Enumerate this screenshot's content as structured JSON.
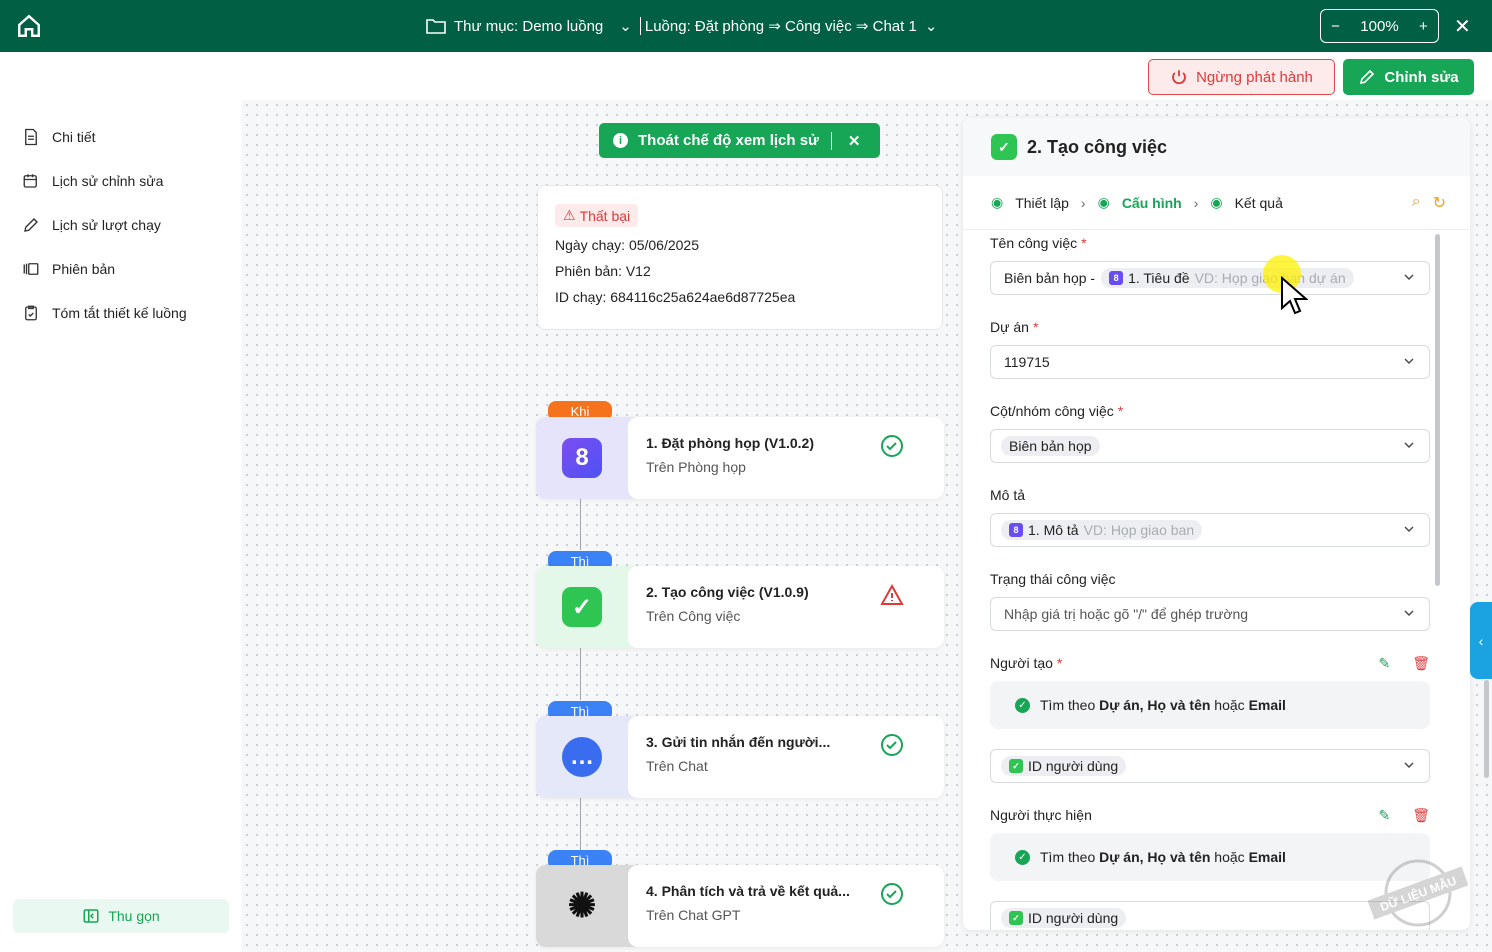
{
  "topbar": {
    "folder": "Thư mục: Demo luồng",
    "flow": "Luồng: Đặt phòng ⇒ Công việc ⇒ Chat 1",
    "zoom": "100%",
    "zoom_minus": "−",
    "zoom_plus": "+",
    "close": "✕"
  },
  "actions": {
    "stop": "Ngừng phát hành",
    "edit": "Chỉnh sửa"
  },
  "sidebar": {
    "items": [
      {
        "label": "Chi tiết",
        "icon": "document-icon"
      },
      {
        "label": "Lịch sử chỉnh sửa",
        "icon": "calendar-history-icon"
      },
      {
        "label": "Lịch sử lượt chạy",
        "icon": "pen-history-icon"
      },
      {
        "label": "Phiên bản",
        "icon": "versions-icon"
      },
      {
        "label": "Tóm tắt thiết kế luồng",
        "icon": "clipboard-icon"
      }
    ],
    "collapse": "Thu gọn"
  },
  "history_banner": {
    "label": "Thoát chế độ xem lịch sử",
    "close": "✕"
  },
  "run_info": {
    "status": "Thất bại",
    "date_label": "Ngày chạy:",
    "date": "05/06/2025",
    "version_label": "Phiên bản:",
    "version": "V12",
    "id_label": "ID chạy:",
    "id": "684116c25a624ae6d87725ea"
  },
  "nodes": [
    {
      "tag": "Khi",
      "title": "1.  Đặt phòng họp (V1.0.2)",
      "subtitle": "Trên Phòng họp",
      "status": "success",
      "tag_color": "#f5731c",
      "bg": "#e6e4fb"
    },
    {
      "tag": "Thì",
      "title": "2.  Tạo công việc (V1.0.9)",
      "subtitle": "Trên Công việc",
      "status": "warning",
      "tag_color": "#3b82f6",
      "bg": "#e3f8e8"
    },
    {
      "tag": "Thì",
      "title": "3.  Gửi tin nhắn đến người...",
      "subtitle": "Trên Chat",
      "status": "success",
      "tag_color": "#3b82f6",
      "bg": "#e4e8f8"
    },
    {
      "tag": "Thì",
      "title": "4.  Phân tích và trả về kết quả...",
      "subtitle": "Trên Chat GPT",
      "status": "success",
      "tag_color": "#3b82f6",
      "bg": "#d9d9d9"
    }
  ],
  "panel": {
    "title": "2. Tạo công việc",
    "steps": [
      "Thiết lập",
      "Cấu hình",
      "Kết quả"
    ],
    "fields": {
      "name": {
        "label": "Tên công việc",
        "prefix": "Biên bản họp -",
        "chip": "1. Tiêu đề",
        "chip_hint": "VD: Họp giao ban dự án"
      },
      "project": {
        "label": "Dự án",
        "value": "119715"
      },
      "column": {
        "label": "Cột/nhóm công việc",
        "chip": "Biên bản họp"
      },
      "desc": {
        "label": "Mô tả",
        "chip": "1. Mô tả",
        "chip_hint": "VD: Họp giao ban"
      },
      "status": {
        "label": "Trạng thái công việc",
        "placeholder": "Nhập giá trị hoặc gõ \"/\" để ghép trường"
      },
      "creator": {
        "label": "Người tạo",
        "find_pre": "Tìm theo ",
        "find_b1": "Dự án, Họ và tên",
        "find_mid": " hoặc ",
        "find_b2": "Email",
        "chip": "ID người dùng"
      },
      "assignee": {
        "label": "Người thực hiện",
        "find_pre": "Tìm theo ",
        "find_b1": "Dự án, Họ và tên",
        "find_mid": " hoặc ",
        "find_b2": "Email",
        "chip": "ID người dùng"
      }
    }
  },
  "watermark": "DỮ LIỆU MẪU",
  "colors": {
    "brand": "#015f44",
    "accent": "#17a556",
    "danger": "#e03a3a"
  }
}
